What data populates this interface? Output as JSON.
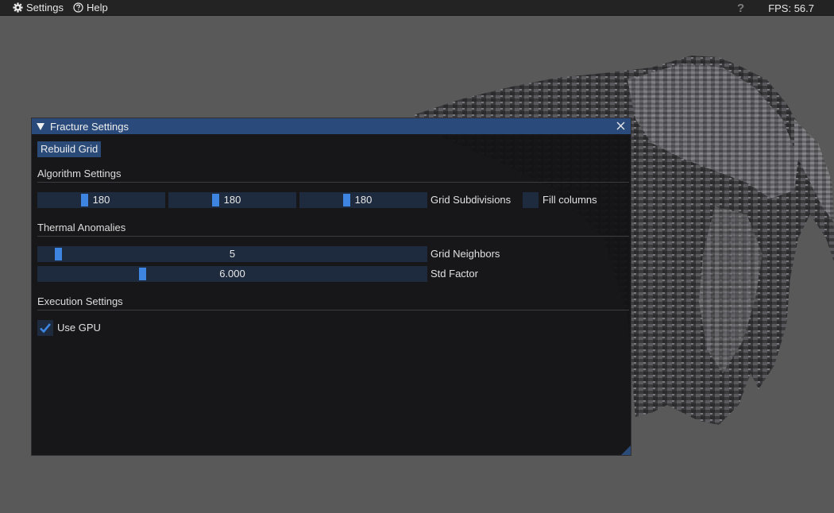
{
  "menubar": {
    "settings_label": "Settings",
    "help_label": "Help",
    "help_badge": "?",
    "fps": "FPS: 56.7",
    "settings_icon": "gear-icon",
    "help_icon": "question-circle-icon"
  },
  "window": {
    "title": "Fracture Settings",
    "rebuild_label": "Rebuild Grid",
    "algorithm_header": "Algorithm Settings",
    "subdivisions": [
      "180",
      "180",
      "180"
    ],
    "subdivisions_label": "Grid Subdivisions",
    "fill_columns_label": "Fill columns",
    "fill_columns_checked": false,
    "thermal_header": "Thermal Anomalies",
    "neighbors_value": "5",
    "neighbors_label": "Grid Neighbors",
    "std_factor_value": "6.000",
    "std_factor_label": "Std Factor",
    "execution_header": "Execution Settings",
    "use_gpu_label": "Use GPU",
    "use_gpu_checked": true
  },
  "colors": {
    "accent": "#3d85e0",
    "title_bar": "#294a7a",
    "background": "#595959"
  }
}
